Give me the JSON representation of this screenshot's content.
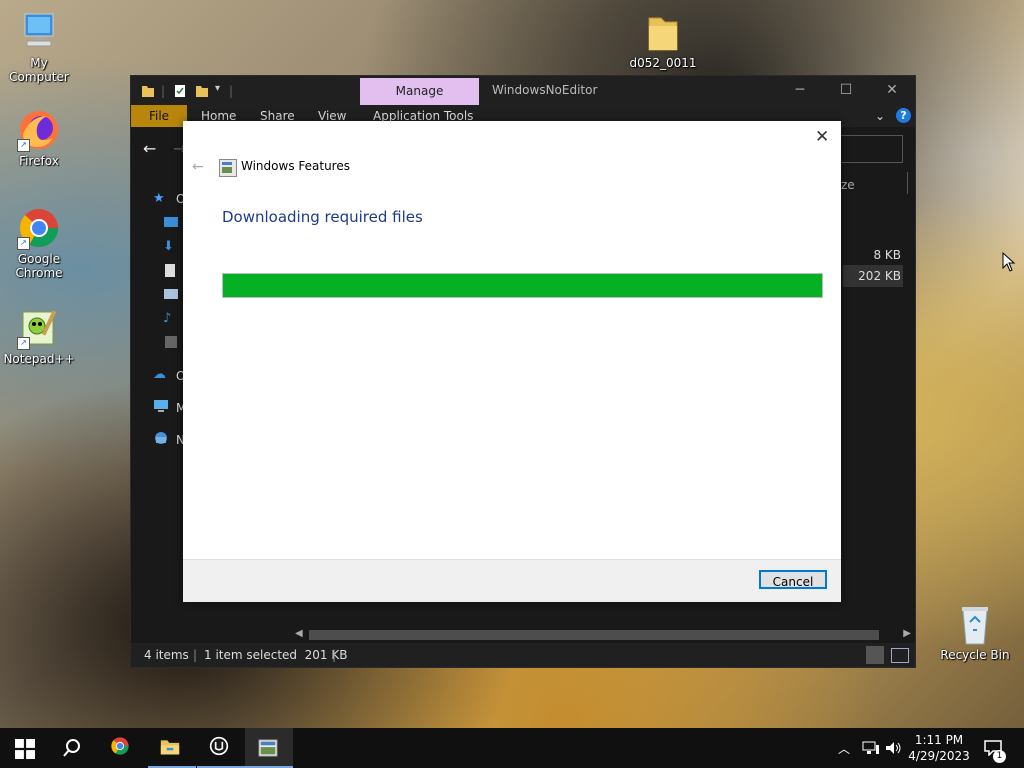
{
  "desktop": {
    "icons": [
      {
        "label": "My Computer"
      },
      {
        "label": "Firefox"
      },
      {
        "label": "Google Chrome"
      },
      {
        "label": "Notepad++"
      },
      {
        "label": "d052_0011"
      },
      {
        "label": "Recycle Bin"
      }
    ]
  },
  "explorer": {
    "context_tab": "Manage",
    "window_title": "WindowsNoEditor",
    "ribbon_tabs": [
      "File",
      "Home",
      "Share",
      "View",
      "Application Tools"
    ],
    "column_header_partial": "ze",
    "nav_partial": [
      "O",
      "O",
      "M",
      "N"
    ],
    "file_sizes": [
      "8 KB",
      "202 KB"
    ],
    "status": {
      "items": "4 items",
      "selected": "1 item selected  201 KB"
    }
  },
  "dialog": {
    "title": "Windows Features",
    "heading": "Downloading required files",
    "progress": 1.0,
    "cancel_label": "Cancel"
  },
  "taskbar": {
    "time": "1:11 PM",
    "date": "4/29/2023",
    "notification_count": "1"
  },
  "colors": {
    "progress_fill": "#06b025",
    "heading": "#1e3a8a",
    "manage_tab": "#e3bff0",
    "file_tab": "#b8860b",
    "accent": "#0078d7"
  }
}
